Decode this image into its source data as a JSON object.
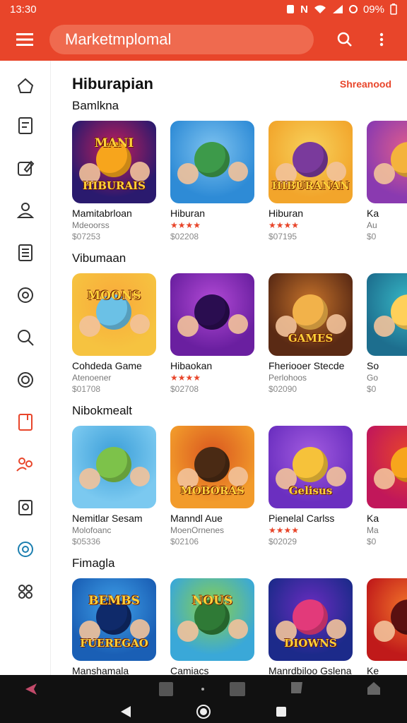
{
  "status": {
    "time": "13:30",
    "battery": "09%",
    "network_letter": "N"
  },
  "app_bar": {
    "title": "Marketmplomal"
  },
  "main": {
    "title": "Hiburapian",
    "see_all": "Shreanood",
    "sections": [
      {
        "title": "Bamlkna",
        "cards": [
          {
            "title": "Mamitabrloan",
            "sub": "Mdeoorss",
            "price": "$07253",
            "art": "HIBURAIS",
            "art_top": "MANI",
            "colors": [
              "#2a1a6e",
              "#c41e5a",
              "#f7a51c"
            ]
          },
          {
            "title": "Hiburan",
            "sub": "★★★★",
            "price": "$02208",
            "art": "",
            "art_top": "",
            "colors": [
              "#2e8bd6",
              "#7ec3f0",
              "#3d9a4a"
            ]
          },
          {
            "title": "Hiburan",
            "sub": "★★★★",
            "price": "$07195",
            "art": "HIBURANAN",
            "art_top": "",
            "colors": [
              "#f2a52b",
              "#f7d25c",
              "#7a3a9c"
            ]
          },
          {
            "title": "Ka",
            "sub": "Au",
            "price": "$0",
            "art": "",
            "art_top": "",
            "colors": [
              "#8a3ab0",
              "#e15d8c",
              "#f4b33c"
            ]
          }
        ]
      },
      {
        "title": "Vibumaan",
        "cards": [
          {
            "title": "Cohdeda Game",
            "sub": "Atenoener",
            "price": "$01708",
            "art": "",
            "art_top": "MOONS",
            "colors": [
              "#f6c340",
              "#f9a93a",
              "#6bc1e6"
            ]
          },
          {
            "title": "Hibaokan",
            "sub": "★★★★",
            "price": "$02708",
            "art": "",
            "art_top": "",
            "colors": [
              "#6a1fa0",
              "#b24ad6",
              "#2a0d50"
            ]
          },
          {
            "title": "Fheriooer Stecde",
            "sub": "Perlohoos",
            "price": "$02090",
            "art": "GAMES",
            "art_top": "",
            "colors": [
              "#5a2a14",
              "#c6732b",
              "#f2b24a"
            ]
          },
          {
            "title": "So",
            "sub": "Go",
            "price": "$0",
            "art": "",
            "art_top": "",
            "colors": [
              "#1d6e8e",
              "#37b9c7",
              "#ffd05a"
            ]
          }
        ]
      },
      {
        "title": "Nibokmealt",
        "cards": [
          {
            "title": "Nemitlar Sesam",
            "sub": "Molofoanc",
            "price": "$05336",
            "art": "",
            "art_top": "",
            "colors": [
              "#7bc9f0",
              "#3b9ed8",
              "#7dc24a"
            ]
          },
          {
            "title": "Manndl Aue",
            "sub": "MoenOrnenes",
            "price": "$02106",
            "art": "MOBORAS",
            "art_top": "",
            "colors": [
              "#f29b2b",
              "#d9561f",
              "#4a2a14"
            ]
          },
          {
            "title": "Pienelal Carlss",
            "sub": "★★★★",
            "price": "$02029",
            "art": "Gelisus",
            "art_top": "",
            "colors": [
              "#6b2fc0",
              "#a35ce0",
              "#f6c23a"
            ]
          },
          {
            "title": "Ka",
            "sub": "Ma",
            "price": "$0",
            "art": "",
            "art_top": "",
            "colors": [
              "#c1175a",
              "#e8452a",
              "#f7a51c"
            ]
          }
        ]
      },
      {
        "title": "Fimagla",
        "cards": [
          {
            "title": "Manshamala",
            "sub": "",
            "price": "",
            "art": "FUEREGAO",
            "art_top": "BEMBS",
            "colors": [
              "#1a5fb5",
              "#3fa0e8",
              "#0f2a6a"
            ]
          },
          {
            "title": "Camiacs",
            "sub": "",
            "price": "",
            "art": "",
            "art_top": "NOUS",
            "colors": [
              "#3aa8d8",
              "#8ad14a",
              "#2f7a36"
            ]
          },
          {
            "title": "Manrdbiloo Gslena",
            "sub": "",
            "price": "",
            "art": "DIOWNS",
            "art_top": "",
            "colors": [
              "#1c2a8a",
              "#6a2cc0",
              "#e23a7a"
            ]
          },
          {
            "title": "Ke",
            "sub": "",
            "price": "",
            "art": "",
            "art_top": "",
            "colors": [
              "#c01a1a",
              "#f2752a",
              "#5a1010"
            ]
          }
        ]
      }
    ]
  },
  "rail_icons": [
    "home-icon",
    "document-icon",
    "edit-icon",
    "profile-icon",
    "list-icon",
    "chat-icon",
    "search-icon",
    "circle-icon",
    "bookmark-icon",
    "people-icon",
    "camera-icon",
    "support-icon",
    "apps-icon"
  ],
  "colors": {
    "accent": "#e8452a",
    "nav": "#111111"
  }
}
